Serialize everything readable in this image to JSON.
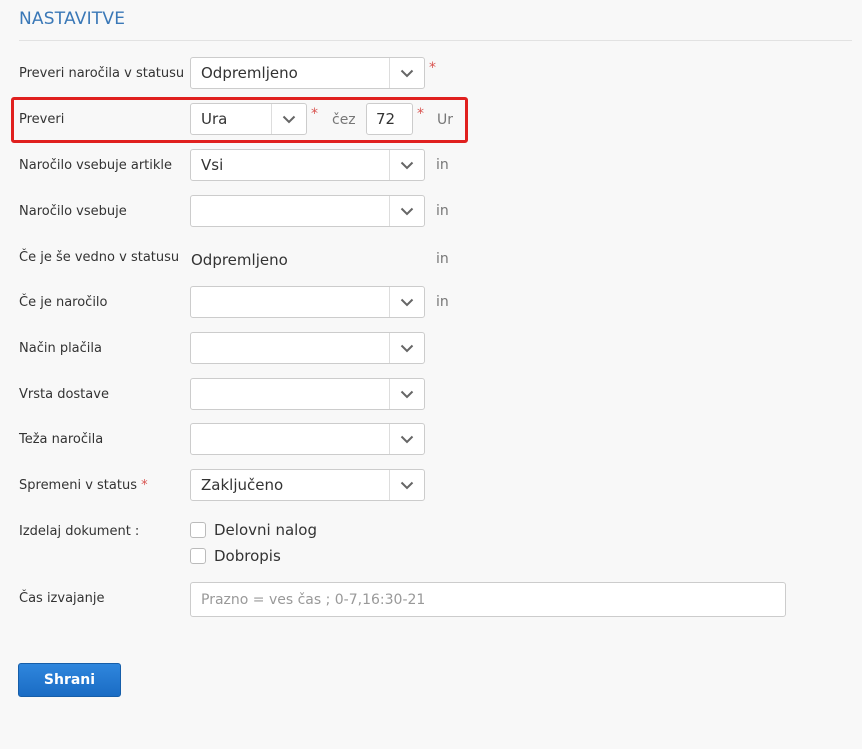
{
  "section": {
    "title": "NASTAVITVE"
  },
  "form": {
    "check_status": {
      "label": "Preveri naročila v statusu",
      "value": "Odpremljeno"
    },
    "check": {
      "label": "Preveri",
      "unit_select": "Ura",
      "over": "čez",
      "number": "72",
      "unit_label": "Ur"
    },
    "contains_articles": {
      "label": "Naročilo vsebuje artikle",
      "value": "Vsi",
      "joiner": "in"
    },
    "contains": {
      "label": "Naročilo vsebuje",
      "value": "",
      "joiner": "in"
    },
    "still_in_status": {
      "label": "Če je še vedno v statusu",
      "value": "Odpremljeno",
      "joiner": "in"
    },
    "if_order": {
      "label": "Če je naročilo",
      "value": "",
      "joiner": "in"
    },
    "payment_method": {
      "label": "Način plačila",
      "value": ""
    },
    "delivery_type": {
      "label": "Vrsta dostave",
      "value": ""
    },
    "order_weight": {
      "label": "Teža naročila",
      "value": ""
    },
    "change_status": {
      "label": "Spremeni v status",
      "required": "*",
      "value": "Zaključeno"
    },
    "make_document": {
      "label": "Izdelaj dokument :",
      "options": [
        "Delovni nalog",
        "Dobropis"
      ]
    },
    "execution_time": {
      "label": "Čas izvajanje",
      "placeholder": "Prazno = ves čas ; 0-7,16:30-21",
      "value": ""
    }
  },
  "actions": {
    "save_label": "Shrani"
  },
  "required_marker": "*"
}
